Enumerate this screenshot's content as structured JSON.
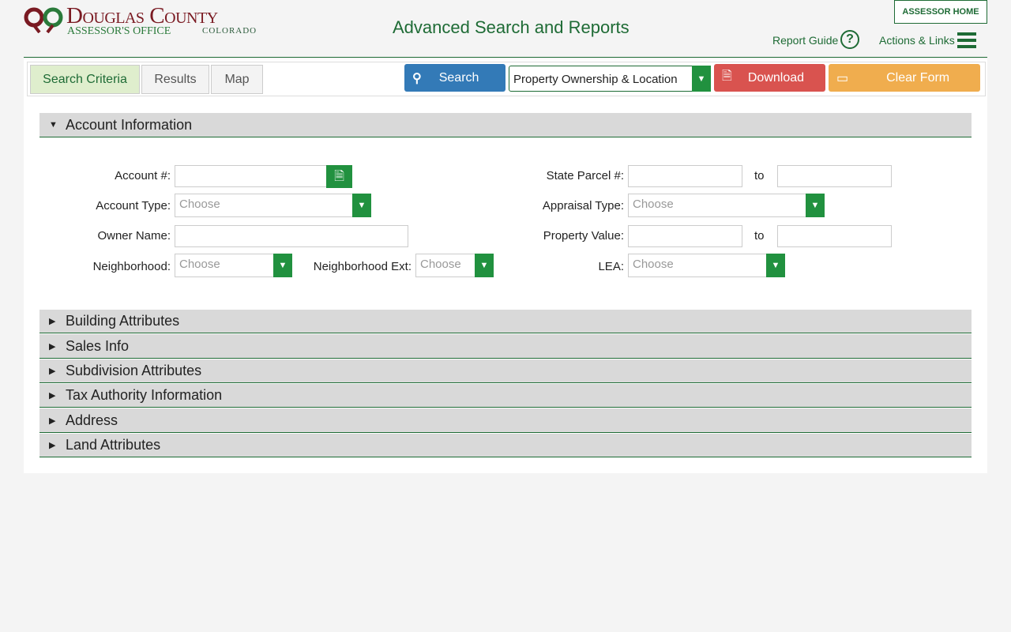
{
  "header": {
    "logo_text": "Douglas County",
    "logo_sub": "ASSESSOR'S OFFICE",
    "logo_state": "COLORADO",
    "title": "Advanced Search and Reports",
    "assessor_home": "ASSESSOR HOME",
    "report_guide": "Report Guide",
    "actions_links": "Actions & Links"
  },
  "tabs": [
    "Search Criteria",
    "Results",
    "Map"
  ],
  "toolbar": {
    "search": "Search",
    "report_type": "Property Ownership & Location",
    "download": "Download",
    "clear": "Clear Form"
  },
  "account": {
    "title": "Account Information",
    "account_no": "Account #:",
    "account_type": "Account Type:",
    "owner_name": "Owner Name:",
    "neighborhood": "Neighborhood:",
    "neighborhood_ext": "Neighborhood Ext:",
    "state_parcel": "State Parcel #:",
    "appraisal_type": "Appraisal Type:",
    "property_value": "Property Value:",
    "lea": "LEA:",
    "to": "to",
    "choose": "Choose"
  },
  "sections": [
    "Building Attributes",
    "Sales Info",
    "Subdivision Attributes",
    "Tax Authority Information",
    "Address",
    "Land Attributes"
  ]
}
